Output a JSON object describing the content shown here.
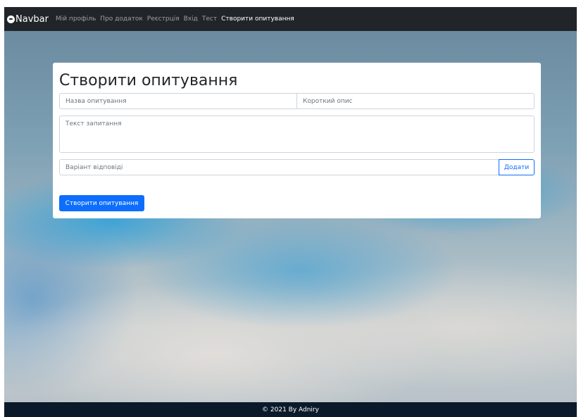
{
  "navbar": {
    "brand": "Navbar",
    "links": [
      {
        "label": "Мій профіль"
      },
      {
        "label": "Про додаток"
      },
      {
        "label": "Реєстрція"
      },
      {
        "label": "Вхід"
      },
      {
        "label": "Тест"
      },
      {
        "label": "Створити опитування",
        "active": true
      }
    ]
  },
  "form": {
    "title": "Створити опитування",
    "survey_name_placeholder": "Назва опитування",
    "short_description_placeholder": "Короткий опис",
    "question_text_placeholder": "Текст запитання",
    "answer_option_placeholder": "Варіант відповіді",
    "add_button_label": "Додати",
    "create_button_label": "Створити опитування"
  },
  "footer": {
    "text": "© 2021 By Adniry"
  },
  "colors": {
    "navbar_bg": "#212529",
    "footer_bg": "#0b1a2b",
    "primary": "#0d6efd"
  }
}
